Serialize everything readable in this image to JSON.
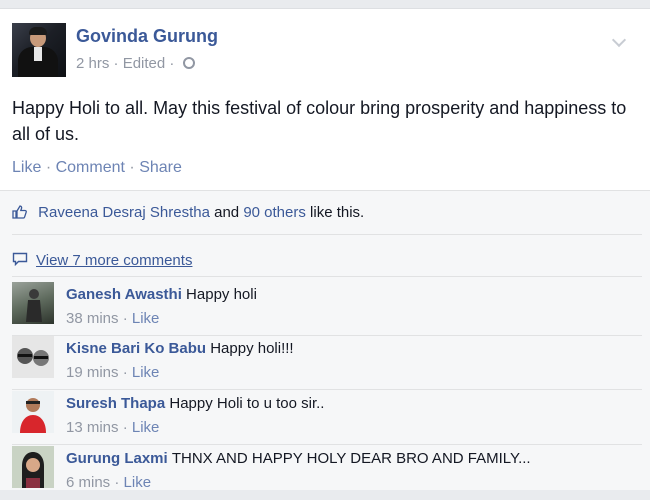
{
  "post": {
    "author": "Govinda Gurung",
    "time": "2 hrs",
    "edited": "Edited",
    "text": "Happy Holi to all. May this festival of colour bring prosperity and happiness to all of us.",
    "actions": {
      "like": "Like",
      "comment": "Comment",
      "share": "Share"
    }
  },
  "likes": {
    "first_name": "Raveena Desraj Shrestha",
    "and": " and ",
    "others": "90 others",
    "suffix": " like this."
  },
  "view_more": "View 7 more comments",
  "comments": [
    {
      "name": "Ganesh Awasthi",
      "text": "Happy holi",
      "time": "38 mins",
      "like": "Like"
    },
    {
      "name": "Kisne Bari Ko Babu",
      "text": "Happy holi!!!",
      "time": "19 mins",
      "like": "Like"
    },
    {
      "name": "Suresh Thapa",
      "text": "Happy Holi to u too sir..",
      "time": "13 mins",
      "like": "Like"
    },
    {
      "name": "Gurung Laxmi",
      "text": "THNX AND HAPPY HOLY DEAR BRO AND FAMILY...",
      "time": "6 mins",
      "like": "Like"
    }
  ],
  "colors": {
    "link": "#3b5998",
    "meta": "#9197a3",
    "action": "#6d84b4",
    "background": "#e9ebee"
  }
}
